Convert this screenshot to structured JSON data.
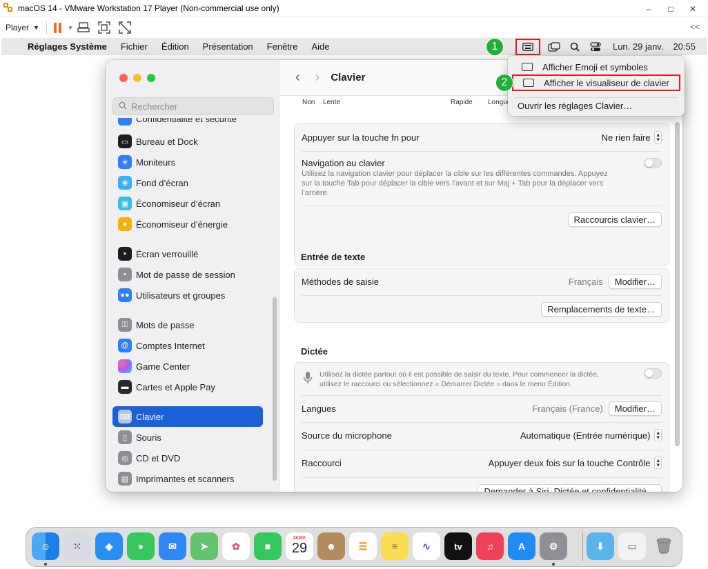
{
  "vm": {
    "title": "macOS 14 - VMware Workstation 17 Player (Non-commercial use only)",
    "player_label": "Player",
    "collapse_label": "<<",
    "min_glyph": "–",
    "max_glyph": "□",
    "close_glyph": "✕"
  },
  "menubar": {
    "app_name": "Réglages Système",
    "items": [
      "Fichier",
      "Édition",
      "Présentation",
      "Fenêtre",
      "Aide"
    ],
    "date": "Lun. 29 janv.",
    "time": "20:55"
  },
  "dropdown": {
    "items": [
      "Afficher Emoji et symboles",
      "Afficher le visualiseur de clavier",
      "Ouvrir les réglages Clavier…"
    ]
  },
  "markers": [
    "1",
    "2"
  ],
  "sidebar": {
    "search_placeholder": "Rechercher",
    "partial_top": "Confidentialité et sécurité",
    "items": [
      {
        "label": "Bureau et Dock",
        "color": "#1d1d1f"
      },
      {
        "label": "Moniteurs",
        "color": "#2f7ff5"
      },
      {
        "label": "Fond d’écran",
        "color": "#35b3f0"
      },
      {
        "label": "Économiseur d’écran",
        "color": "#3cbde6"
      },
      {
        "label": "Économiseur d’énergie",
        "color": "#f5b00b"
      },
      {
        "label": "Écran verrouillé",
        "color": "#1d1d1f"
      },
      {
        "label": "Mot de passe de session",
        "color": "#8e8e93"
      },
      {
        "label": "Utilisateurs et groupes",
        "color": "#2f7ff5"
      },
      {
        "label": "Mots de passe",
        "color": "#8e8e93"
      },
      {
        "label": "Comptes Internet",
        "color": "#2f7ff5"
      },
      {
        "label": "Game Center",
        "color": "#e85bc2"
      },
      {
        "label": "Cartes et Apple Pay",
        "color": "#2b2b2b"
      },
      {
        "label": "Clavier",
        "color": "#8e8e93"
      },
      {
        "label": "Souris",
        "color": "#8e8e93"
      },
      {
        "label": "CD et DVD",
        "color": "#8e8e93"
      },
      {
        "label": "Imprimantes et scanners",
        "color": "#8e8e93"
      }
    ]
  },
  "content": {
    "title": "Clavier",
    "slider_labels": [
      "Non",
      "Lente",
      "Rapide",
      "Longue"
    ],
    "fn_label": "Appuyer sur la touche fn pour",
    "fn_value": "Ne rien faire",
    "nav_label": "Navigation au clavier",
    "nav_desc_1": "Utilisez la navigation clavier pour déplacer la cible sur les différentes commandes. Appuyez",
    "nav_desc_2": "sur la touche Tab pour déplacer la cible vers l’avant et sur Maj + Tab pour la déplacer vers",
    "nav_desc_3": "l’arrière.",
    "shortcuts_btn": "Raccourcis clavier…",
    "text_input_title": "Entrée de texte",
    "input_methods_label": "Méthodes de saisie",
    "input_methods_value": "Français",
    "modify_btn": "Modifier…",
    "replacements_btn": "Remplacements de texte…",
    "dictation_title": "Dictée",
    "dict_desc_1": "Utilisez la dictée partout où il est possible de saisir du texte. Pour commencer la dictée,",
    "dict_desc_2": "utilisez le raccourci ou sélectionnez « Démarrer Dictée » dans le menu Édition.",
    "languages_label": "Langues",
    "languages_value": "Français (France)",
    "mic_label": "Source du microphone",
    "mic_value": "Automatique (Entrée numérique)",
    "shortcut_label": "Raccourci",
    "shortcut_value": "Appuyer deux fois sur la touche Contrôle",
    "siri_btn": "Demander à Siri, Dictée et confidentialité…"
  },
  "dock": {
    "calendar_month": "JANV.",
    "calendar_day": "29",
    "tv_label": "tv"
  }
}
